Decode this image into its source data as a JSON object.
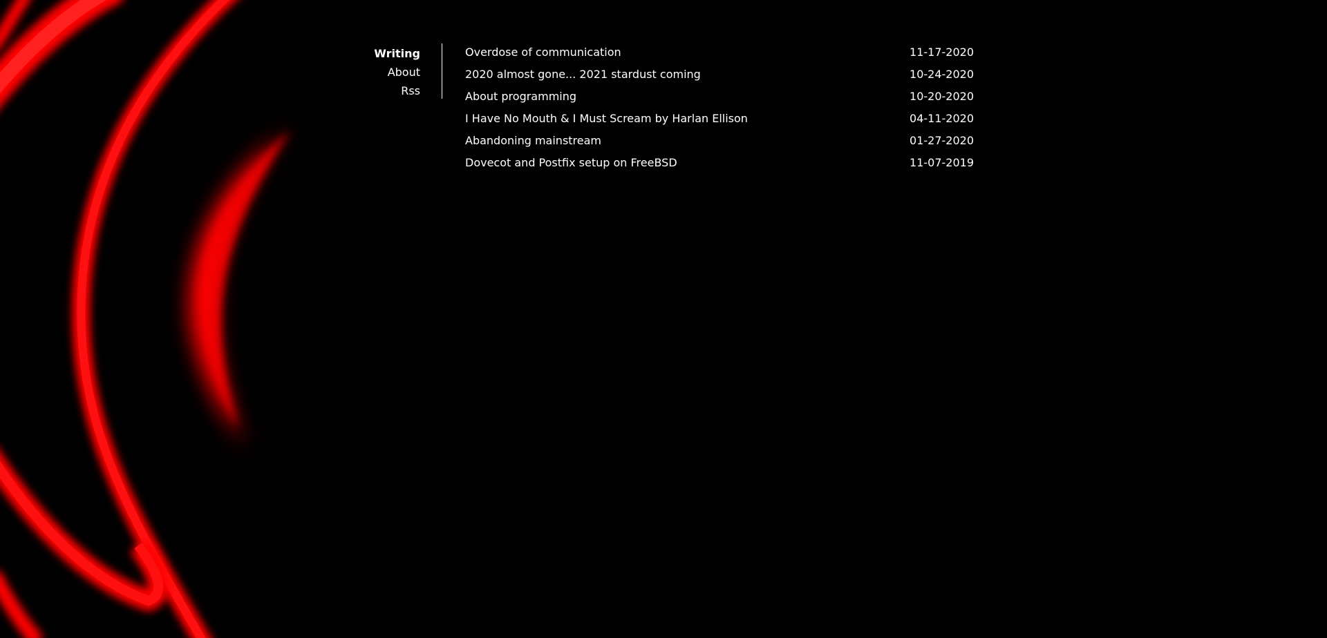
{
  "theme": {
    "background": "#000000",
    "text": "#ffffff",
    "accent": "#ff0000"
  },
  "nav": {
    "items": [
      {
        "label": "Writing",
        "active": true
      },
      {
        "label": "About",
        "active": false
      },
      {
        "label": "Rss",
        "active": false
      }
    ]
  },
  "posts": [
    {
      "title": "Overdose of communication",
      "date": "11-17-2020"
    },
    {
      "title": "2020 almost gone... 2021 stardust coming",
      "date": "10-24-2020"
    },
    {
      "title": "About programming",
      "date": "10-20-2020"
    },
    {
      "title": "I Have No Mouth & I Must Scream by Harlan Ellison",
      "date": "04-11-2020"
    },
    {
      "title": "Abandoning mainstream",
      "date": "01-27-2020"
    },
    {
      "title": "Dovecot and Postfix setup on FreeBSD",
      "date": "11-07-2019"
    }
  ]
}
